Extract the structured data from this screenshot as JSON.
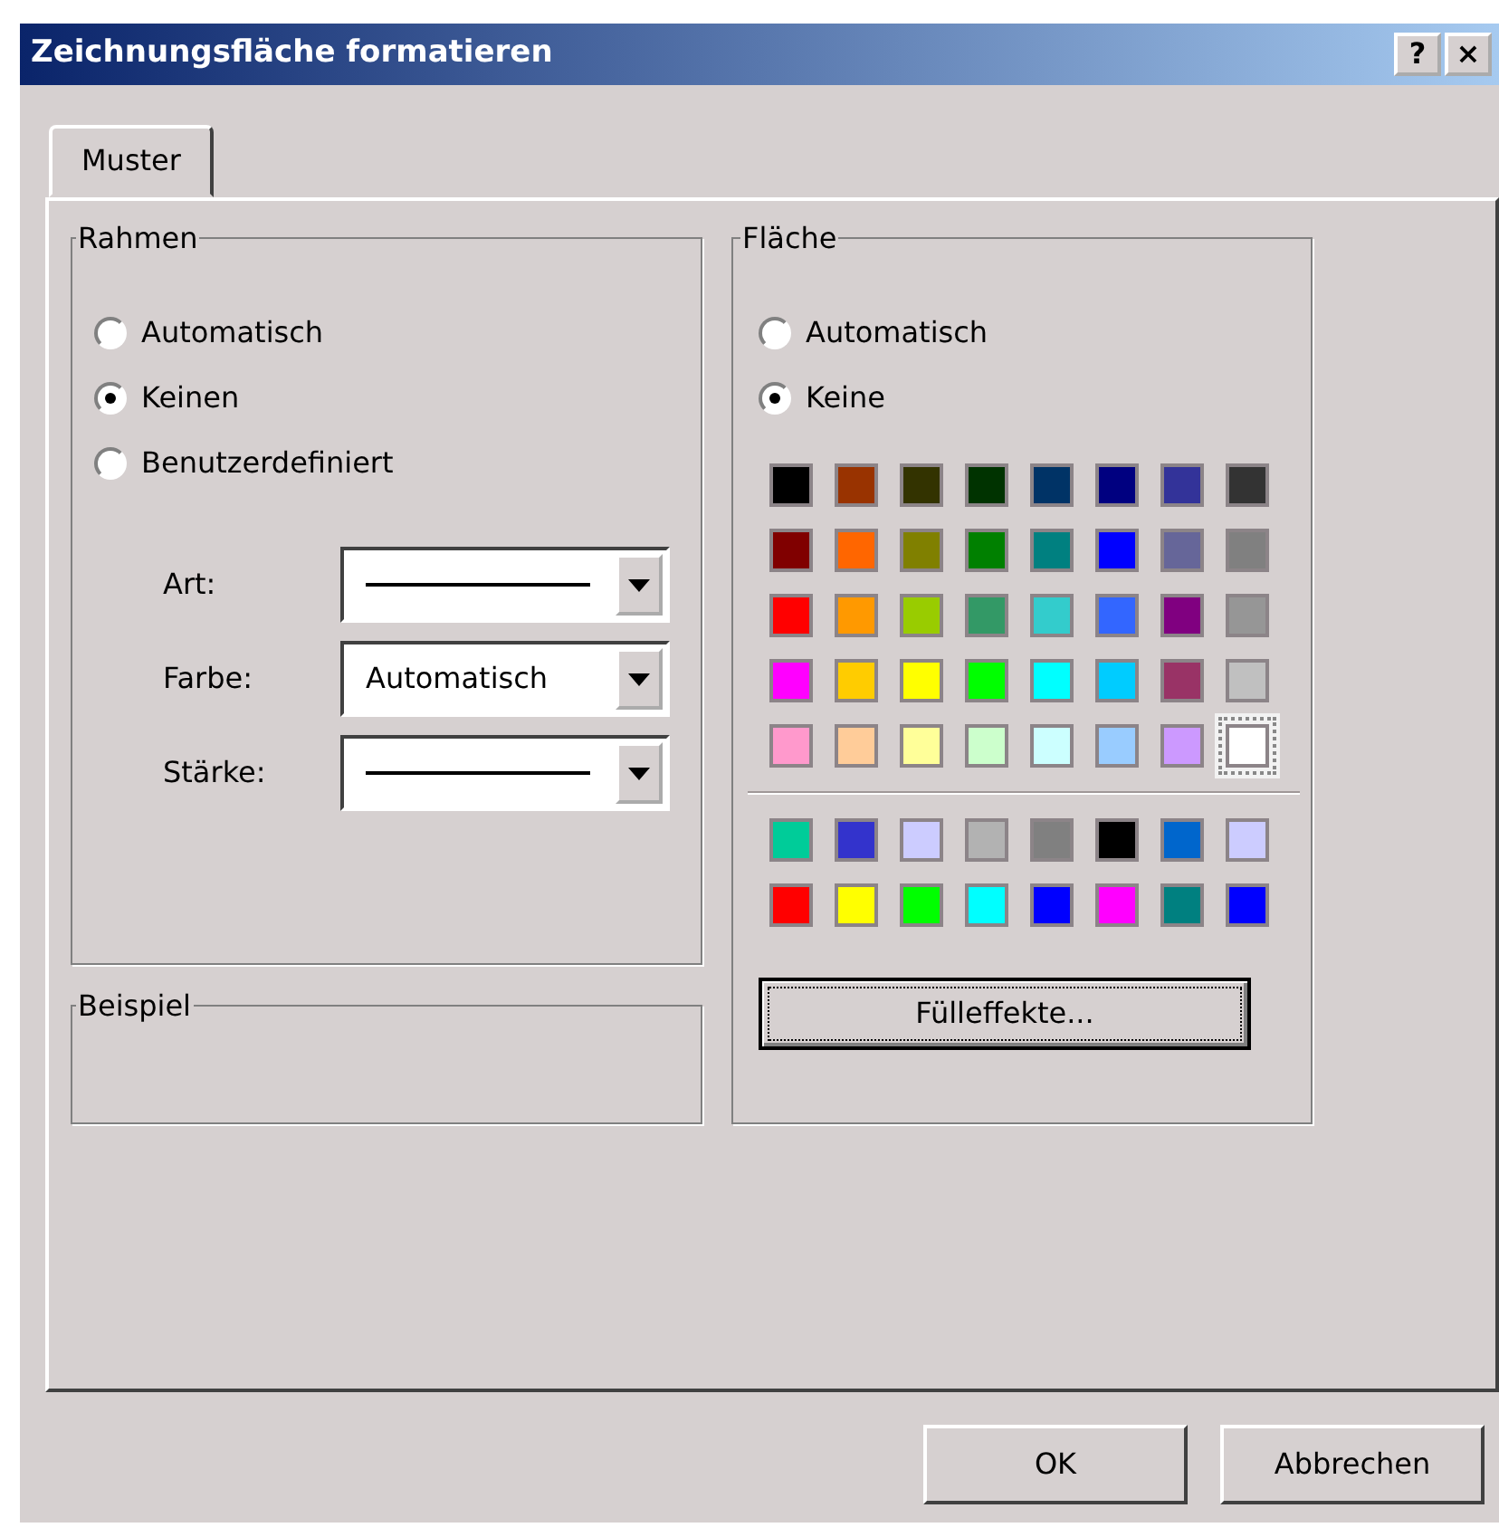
{
  "window": {
    "title": "Zeichnungsfläche formatieren",
    "controls": [
      "?",
      "×"
    ]
  },
  "tabs": [
    {
      "label": "Muster",
      "selected": true
    }
  ],
  "rahmen": {
    "title": "Rahmen",
    "options": [
      {
        "label": "Automatisch",
        "selected": false
      },
      {
        "label": "Keinen",
        "selected": true
      },
      {
        "label": "Benutzerdefiniert",
        "selected": false
      }
    ],
    "fields": [
      {
        "label": "Art:",
        "kind": "line"
      },
      {
        "label": "Farbe:",
        "kind": "text",
        "value": "Automatisch"
      },
      {
        "label": "Stärke:",
        "kind": "line"
      }
    ]
  },
  "beispiel": {
    "title": "Beispiel"
  },
  "flaeche": {
    "title": "Fläche",
    "options": [
      {
        "label": "Automatisch",
        "selected": false
      },
      {
        "label": "Keine",
        "selected": true
      }
    ],
    "palette": [
      {
        "color": "#000000",
        "selected": false
      },
      {
        "color": "#993300",
        "selected": false
      },
      {
        "color": "#333300",
        "selected": false
      },
      {
        "color": "#003300",
        "selected": false
      },
      {
        "color": "#003366",
        "selected": false
      },
      {
        "color": "#000080",
        "selected": false
      },
      {
        "color": "#333399",
        "selected": false
      },
      {
        "color": "#333333",
        "selected": false
      },
      {
        "color": "#800000",
        "selected": false
      },
      {
        "color": "#ff6600",
        "selected": false
      },
      {
        "color": "#808000",
        "selected": false
      },
      {
        "color": "#008000",
        "selected": false
      },
      {
        "color": "#008080",
        "selected": false
      },
      {
        "color": "#0000ff",
        "selected": false
      },
      {
        "color": "#666699",
        "selected": false
      },
      {
        "color": "#808080",
        "selected": false
      },
      {
        "color": "#ff0000",
        "selected": false
      },
      {
        "color": "#ff9900",
        "selected": false
      },
      {
        "color": "#99cc00",
        "selected": false
      },
      {
        "color": "#339966",
        "selected": false
      },
      {
        "color": "#33cccc",
        "selected": false
      },
      {
        "color": "#3366ff",
        "selected": false
      },
      {
        "color": "#800080",
        "selected": false
      },
      {
        "color": "#969696",
        "selected": false
      },
      {
        "color": "#ff00ff",
        "selected": false
      },
      {
        "color": "#ffcc00",
        "selected": false
      },
      {
        "color": "#ffff00",
        "selected": false
      },
      {
        "color": "#00ff00",
        "selected": false
      },
      {
        "color": "#00ffff",
        "selected": false
      },
      {
        "color": "#00ccff",
        "selected": false
      },
      {
        "color": "#993366",
        "selected": false
      },
      {
        "color": "#c0c0c0",
        "selected": false
      },
      {
        "color": "#ff99cc",
        "selected": false
      },
      {
        "color": "#ffcc99",
        "selected": false
      },
      {
        "color": "#ffff99",
        "selected": false
      },
      {
        "color": "#ccffcc",
        "selected": false
      },
      {
        "color": "#ccffff",
        "selected": false
      },
      {
        "color": "#99ccff",
        "selected": false
      },
      {
        "color": "#cc99ff",
        "selected": false
      },
      {
        "color": "#ffffff",
        "selected": true
      }
    ],
    "extra_colors": [
      {
        "color": "#00cc99",
        "selected": false
      },
      {
        "color": "#3333cc",
        "selected": false
      },
      {
        "color": "#ccccff",
        "selected": false
      },
      {
        "color": "#b2b2b2",
        "selected": false
      },
      {
        "color": "#808080",
        "selected": false
      },
      {
        "color": "#000000",
        "selected": false
      },
      {
        "color": "#0066cc",
        "selected": false
      },
      {
        "color": "#ccccff",
        "selected": false
      },
      {
        "color": "#ff0000",
        "selected": false
      },
      {
        "color": "#ffff00",
        "selected": false
      },
      {
        "color": "#00ff00",
        "selected": false
      },
      {
        "color": "#00ffff",
        "selected": false
      },
      {
        "color": "#0000ff",
        "selected": false
      },
      {
        "color": "#ff00ff",
        "selected": false
      },
      {
        "color": "#008080",
        "selected": false
      },
      {
        "color": "#0000ff",
        "selected": false
      }
    ],
    "button": "Fülleffekte..."
  },
  "buttons": [
    "OK",
    "Abbrechen"
  ]
}
